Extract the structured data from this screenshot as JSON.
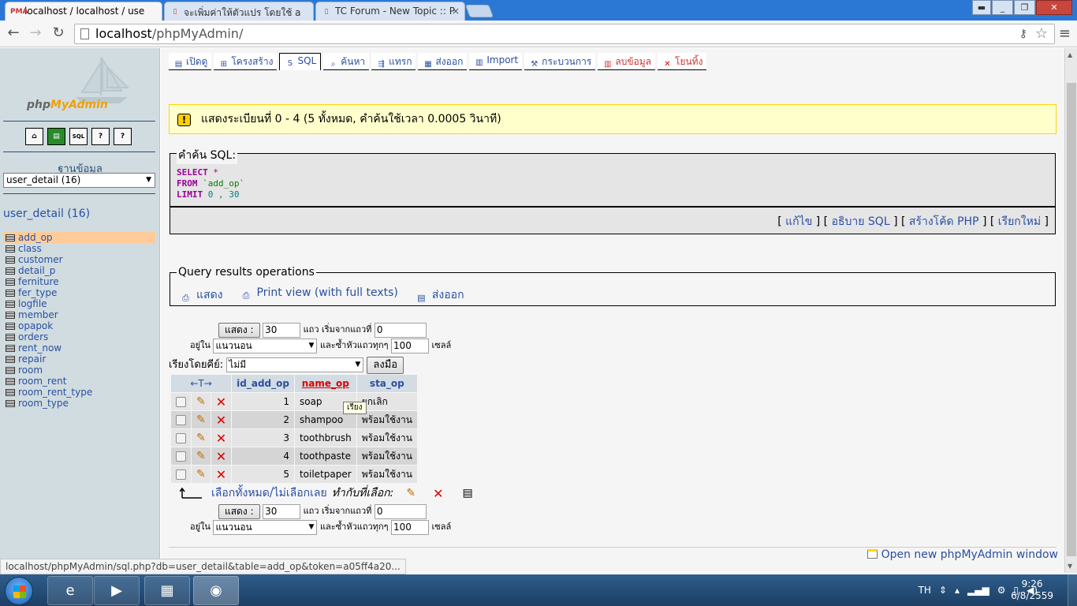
{
  "browser": {
    "tabs": [
      {
        "label": "localhost / localhost / use",
        "icon": "pma-icon"
      },
      {
        "label": "จะเพิ่มค่าให้ตัวแปร โดยใช้ a",
        "icon": "page-icon"
      },
      {
        "label": "TC Forum - New Topic :: P",
        "icon": "page-icon"
      }
    ],
    "tab_icon_text": "PMA",
    "url_host": "localhost",
    "url_path": "/phpMyAdmin/",
    "status_url": "localhost/phpMyAdmin/sql.php?db=user_detail&table=add_op&token=a05ff4a20..."
  },
  "nav": {
    "logo_php": "php",
    "logo_myadmin": "MyAdmin",
    "icon_labels": [
      "⌂",
      "▤",
      "SQL",
      "?",
      "?"
    ],
    "db_label": "ฐานข้อมูล",
    "db_selected": "user_detail (16)",
    "db_title": "user_detail (16)",
    "tables": [
      "add_op",
      "class",
      "customer",
      "detail_p",
      "ferniture",
      "fer_type",
      "logfile",
      "member",
      "opapok",
      "orders",
      "rent_now",
      "repair",
      "room",
      "room_rent",
      "room_rent_type",
      "room_type"
    ],
    "selected_table": "add_op"
  },
  "menu": {
    "items": [
      {
        "label": "เปิดดู",
        "icon": "browse-icon"
      },
      {
        "label": "โครงสร้าง",
        "icon": "structure-icon"
      },
      {
        "label": "SQL",
        "icon": "sql-icon"
      },
      {
        "label": "ค้นหา",
        "icon": "search-icon"
      },
      {
        "label": "แทรก",
        "icon": "insert-icon"
      },
      {
        "label": "ส่งออก",
        "icon": "export-icon"
      },
      {
        "label": "Import",
        "icon": "import-icon"
      },
      {
        "label": "กระบวนการ",
        "icon": "operations-icon"
      },
      {
        "label": "ลบข้อมูล",
        "icon": "empty-icon"
      },
      {
        "label": "โยนทิ้ง",
        "icon": "drop-icon"
      }
    ]
  },
  "notice": {
    "text": "แสดงระเบียนที่ 0 - 4 (5 ทั้งหมด, คำค้นใช้เวลา 0.0005 วินาที)",
    "icon_glyph": "!"
  },
  "sql": {
    "legend": "คำค้น SQL:",
    "kw_select": "SELECT",
    "select_rest": " *",
    "kw_from": "FROM",
    "table": " `add_op`",
    "kw_limit": "LIMIT",
    "limit_rest": " 0 , 30",
    "links": [
      "แก้ไข",
      "อธิบาย SQL",
      "สร้างโค้ด PHP",
      "เรียกใหม่"
    ]
  },
  "qro": {
    "legend": "Query results operations",
    "links": [
      "แสดง",
      "Print view (with full texts)",
      "ส่งออก"
    ]
  },
  "navform": {
    "show_button": "แสดง :",
    "rows_value": "30",
    "rows_text": "แถว เริ่มจากแถวที่",
    "start_value": "0",
    "mode_label": "อยู่ใน",
    "mode_value": "แนวนอน",
    "repeat_text": "และซ้ำหัวแถวทุกๆ",
    "repeat_value": "100",
    "cells_text": "เซลล์"
  },
  "sort": {
    "label": "เรียงโดยคีย์:",
    "value": "ไม่มี",
    "go_button": "ลงมือ"
  },
  "results": {
    "columns": [
      "id_add_op",
      "name_op",
      "sta_op"
    ],
    "sorted_column": "name_op",
    "col_resize_glyph": "←T→",
    "rows": [
      [
        "1",
        "soap",
        "ยกเลิก"
      ],
      [
        "2",
        "shampoo",
        "พร้อมใช้งาน"
      ],
      [
        "3",
        "toothbrush",
        "พร้อมใช้งาน"
      ],
      [
        "4",
        "toothpaste",
        "พร้อมใช้งาน"
      ],
      [
        "5",
        "toiletpaper",
        "พร้อมใช้งาน"
      ]
    ],
    "tooltip": "เรียง"
  },
  "bulk": {
    "check_all": "เลือกทั้งหมด",
    "separator": " / ",
    "uncheck_all": "ไม่เลือกเลย",
    "with_selected": "ทำกับที่เลือก:"
  },
  "footer": {
    "open_window": "Open new phpMyAdmin window"
  },
  "taskbar": {
    "lang": "TH",
    "time": "9:26",
    "date": "6/8/2559"
  }
}
